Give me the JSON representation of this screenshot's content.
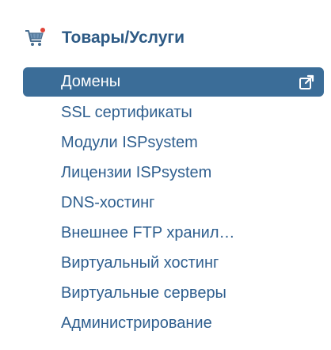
{
  "section": {
    "title": "Товары/Услуги",
    "icon": "shopping-cart-icon"
  },
  "menu": {
    "items": [
      {
        "label": "Домены",
        "active": true,
        "icon": "external-link-icon"
      },
      {
        "label": "SSL сертификаты",
        "active": false
      },
      {
        "label": "Модули ISPsystem",
        "active": false
      },
      {
        "label": "Лицензии ISPsystem",
        "active": false
      },
      {
        "label": "DNS-хостинг",
        "active": false
      },
      {
        "label": "Внешнее FTP хранил…",
        "active": false
      },
      {
        "label": "Виртуальный хостинг",
        "active": false
      },
      {
        "label": "Виртуальные серверы",
        "active": false
      },
      {
        "label": "Администрирование",
        "active": false
      }
    ]
  },
  "colors": {
    "title": "#2d5a85",
    "link": "#2f5f8f",
    "active_bg": "#3b6d98",
    "active_text": "#ffffff",
    "cart_badge": "#e0453a"
  }
}
